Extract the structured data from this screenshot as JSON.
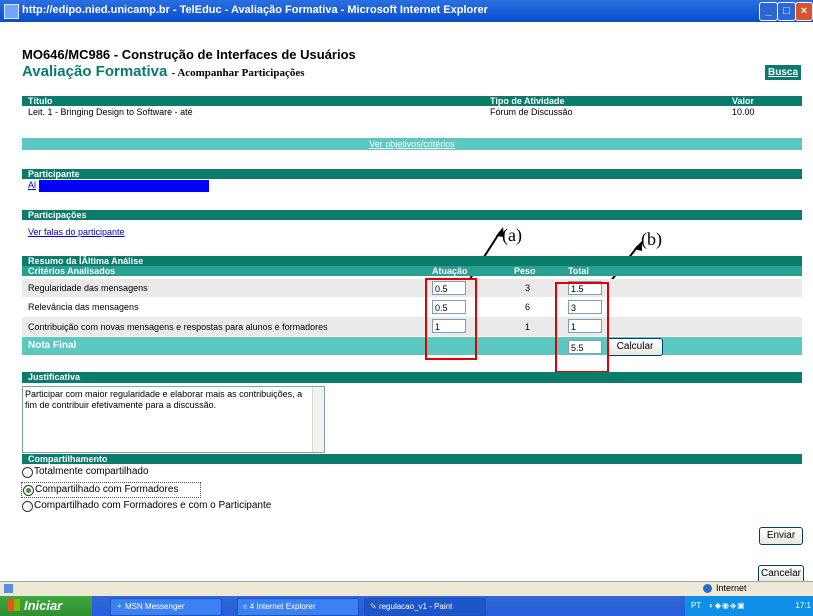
{
  "window": {
    "title": "http://edipo.nied.unicamp.br - TelEduc - Avaliação Formativa - Microsoft Internet Explorer"
  },
  "header": {
    "course": "MO646/MC986 - Construção de Interfaces de Usuários",
    "section_title": "Avaliação Formativa",
    "section_subtitle": "- Acompanhar Participações",
    "busca": "Busca"
  },
  "activity": {
    "col_title": "Título",
    "col_type": "Tipo de Atividade",
    "col_value": "Valor",
    "title": "Leit. 1 - Bringing Design to Software - até",
    "type": "Fórum de Discussão",
    "value": "10.00",
    "objectives_link": "Ver objetivos/critérios"
  },
  "participant": {
    "header": "Participante",
    "name": "Al",
    "redaction_color": "#0000ff"
  },
  "participations": {
    "header": "Participações",
    "link": "Ver falas do participante"
  },
  "annotations": {
    "a": "(a)",
    "b": "(b)"
  },
  "summary": {
    "header": "Resumo da ÍÂltima Análise",
    "col_criteria": "Critérios Analisados",
    "col_score": "Atuação",
    "col_weight": "Peso",
    "col_total": "Total",
    "rows": [
      {
        "criterion": "Regularidade das mensagens",
        "score": "0.5",
        "weight": "3",
        "total": "1.5"
      },
      {
        "criterion": "Relevância das mensagens",
        "score": "0.5",
        "weight": "6",
        "total": "3"
      },
      {
        "criterion": "Contribuição com novas mensagens e respostas para alunos e formadores",
        "score": "1",
        "weight": "1",
        "total": "1"
      }
    ],
    "final_label": "Nota Final",
    "final_value": "5.5",
    "calc_button": "Calcular"
  },
  "justification": {
    "header": "Justificativa",
    "text": "Participar com maior regularidade e elaborar mais as contribuições,  a fim de contribuir efetivamente para a discussão."
  },
  "sharing": {
    "header": "Compartilhamento",
    "options": [
      {
        "label": "Totalmente compartilhado",
        "selected": false
      },
      {
        "label": "Compartilhado com Formadores",
        "selected": true
      },
      {
        "label": "Compartilhado com Formadores e com o Participante",
        "selected": false
      }
    ]
  },
  "buttons": {
    "send": "Enviar",
    "cancel": "Cancelar"
  },
  "status": {
    "zone": "Internet"
  },
  "taskbar": {
    "start": "Iniciar",
    "tasks": [
      "MSN Messenger",
      "4 Internet Explorer",
      "regulacao_v1 - Paint"
    ],
    "lang": "PT",
    "clock": "17:1"
  },
  "colors": {
    "section_bar": "#0b7c6c",
    "light_band": "#5cc8c0",
    "highlight": "#e00000"
  }
}
